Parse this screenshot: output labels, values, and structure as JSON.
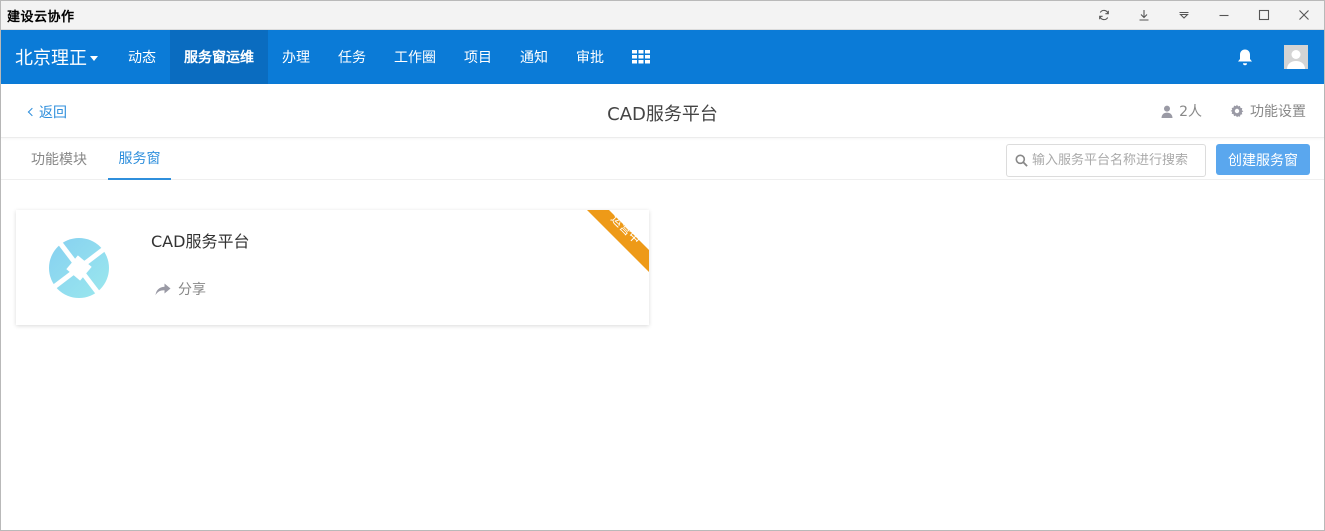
{
  "window": {
    "title": "建设云协作",
    "controls": [
      "refresh-icon",
      "download-icon",
      "dropdown-icon",
      "minimize-icon",
      "maximize-icon",
      "close-icon"
    ]
  },
  "navbar": {
    "org_name": "北京理正",
    "items": [
      {
        "label": "动态"
      },
      {
        "label": "服务窗运维",
        "active": true
      },
      {
        "label": "办理"
      },
      {
        "label": "任务"
      },
      {
        "label": "工作圈"
      },
      {
        "label": "项目"
      },
      {
        "label": "通知"
      },
      {
        "label": "审批"
      }
    ],
    "bg_color": "#0b7bd7"
  },
  "header": {
    "back_label": "返回",
    "title": "CAD服务平台",
    "members_label": "2人",
    "settings_label": "功能设置"
  },
  "tabs": {
    "items": [
      {
        "label": "功能模块",
        "active": false
      },
      {
        "label": "服务窗",
        "active": true
      }
    ],
    "search_placeholder": "输入服务平台名称进行搜索",
    "create_button_label": "创建服务窗"
  },
  "cards": [
    {
      "title": "CAD服务平台",
      "share_label": "分享",
      "status_ribbon": "运营中",
      "ribbon_color": "#ee9a18"
    }
  ]
}
